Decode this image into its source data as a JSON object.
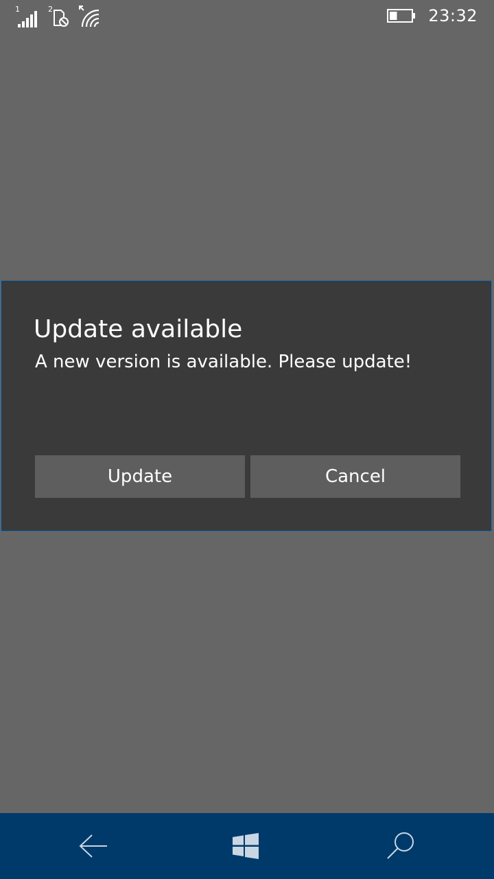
{
  "status_bar": {
    "sim1_label": "1",
    "sim2_label": "2",
    "time": "23:32",
    "battery_level": 0.35,
    "icons": [
      "signal-strength-icon",
      "sim-blocked-icon",
      "wifi-icon",
      "battery-icon"
    ]
  },
  "dialog": {
    "title": "Update available",
    "message": "A new version is available. Please update!",
    "buttons": {
      "update_label": "Update",
      "cancel_label": "Cancel"
    }
  },
  "nav_bar": {
    "icons": [
      "back-arrow-icon",
      "windows-start-icon",
      "search-icon"
    ]
  },
  "colors": {
    "background": "#666666",
    "dialog_background": "#3a3a3a",
    "dialog_border": "#1f6fb5",
    "button_background": "#5e5e5e",
    "nav_bar_background": "#003a6a",
    "text": "#ffffff"
  }
}
